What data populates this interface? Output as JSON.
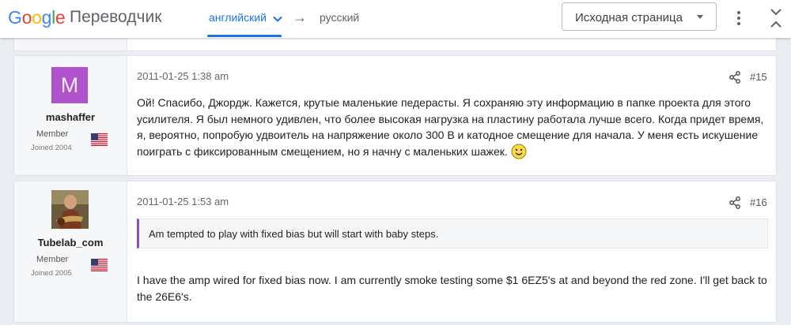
{
  "translate_bar": {
    "logo_letters": [
      "G",
      "o",
      "o",
      "g",
      "l",
      "e"
    ],
    "product": "Переводчик",
    "source_lang": "английский",
    "target_lang": "русский",
    "arrow": "→",
    "original_button": "Исходная страница",
    "accent": "#1a73e8"
  },
  "posts": [
    {
      "avatar_letter": "M",
      "avatar_color": "#b052cc",
      "username": "mashaffer",
      "role": "Member",
      "joined": "Joined 2004",
      "flag": "us-flag",
      "date": "2011-01-25 1:38 am",
      "number": "#15",
      "text": "Ой! Спасибо, Джордж. Кажется, крутые маленькие педерасты. Я сохраняю эту информацию в папке проекта для этого усилителя. Я был немного удивлен, что более высокая нагрузка на пластину работала лучше всего. Когда придет время, я, вероятно, попробую удвоитель на напряжение около 300 В и катодное смещение для начала. У меня есть искушение поиграть с фиксированным смещением, но я начну с маленьких шажек."
    },
    {
      "avatar_photo": "guitarist-photo",
      "username": "Tubelab_com",
      "role": "Member",
      "joined": "Joined 2005",
      "flag": "us-flag",
      "date": "2011-01-25 1:53 am",
      "number": "#16",
      "quote": "Am tempted to play with fixed bias but will start with baby steps.",
      "text": "I have the amp wired for fixed bias now. I am currently smoke testing some $1 6EZ5's at and beyond the red zone. I'll get back to the 26E6's."
    }
  ]
}
